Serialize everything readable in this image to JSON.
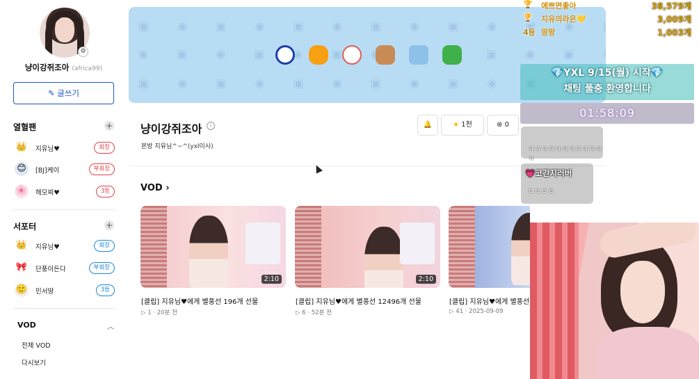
{
  "sidebar": {
    "channel_name": "냥이강쥐조아",
    "channel_id": "(africa99)",
    "write_label": "✎ 글쓰기",
    "fans_title": "열혈팬",
    "fans": [
      {
        "name": "지유님♥",
        "badge": "회장",
        "icon": "👑",
        "color": "red"
      },
      {
        "name": "[BJ]케이",
        "badge": "부회장",
        "icon": "😊",
        "color": "red"
      },
      {
        "name": "헤모찌♥",
        "badge": "3등",
        "icon": "🌸",
        "color": "red"
      }
    ],
    "supporters_title": "서포터",
    "supporters": [
      {
        "name": "지유님♥",
        "badge": "회장",
        "icon": "👑",
        "color": "blue"
      },
      {
        "name": "단풍이든다",
        "badge": "부회장",
        "icon": "🎀",
        "color": "blue"
      },
      {
        "name": "민서땅",
        "badge": "3등",
        "icon": "🙂",
        "color": "blue"
      }
    ],
    "vod_title": "VOD",
    "vod_items": [
      "전체 VOD",
      "다시보기"
    ]
  },
  "channel": {
    "title": "냥이강쥐조아",
    "description": "본방 지유님^~^(yxl이사)",
    "actions": [
      {
        "label": "",
        "icon": "bell-icon"
      },
      {
        "label": "1천",
        "icon": "star-icon"
      },
      {
        "label": "0",
        "icon": "heart-badge-icon"
      },
      {
        "label": "",
        "icon": "gift-icon"
      },
      {
        "label": "",
        "icon": "ad-icon"
      },
      {
        "label": "",
        "icon": "sticker-icon"
      }
    ]
  },
  "vod": {
    "section_title": "VOD ›",
    "items": [
      {
        "title": "[클립] 지유님♥에게 별풍선 196개 선물",
        "meta": "▷ 1 · 20분 전",
        "duration": "2:10"
      },
      {
        "title": "[클립] 지유님♥에게 별풍선 12496개 선물",
        "meta": "▷ 6 · 52분 전",
        "duration": "2:10"
      },
      {
        "title": "[클립] 지유님♥에게 별풍선",
        "meta": "▷ 41 · 2025-09-09",
        "duration": ""
      }
    ]
  },
  "overlay": {
    "ranks": [
      {
        "label": "🏆",
        "name": "예쁘면좋아",
        "count": "38,579개"
      },
      {
        "label": "🏆",
        "name": "지유의라온💛",
        "count": "3,009개"
      },
      {
        "label": "4등",
        "name": "팡팡",
        "count": "1,003개"
      }
    ],
    "notice_line1": "💎YXL 9/15(월) 시작💎",
    "notice_line2": "채팅 풀충 환영합니다",
    "timer": "01:58:09",
    "chats": [
      {
        "user": "",
        "message": "ㅋㅋㅋㅋㅋㅋㅋㅋㅋㅋㅋㅋ"
      },
      {
        "user": "💗코간지러버",
        "message": "ㄷㄷㄷㄷ"
      }
    ]
  }
}
